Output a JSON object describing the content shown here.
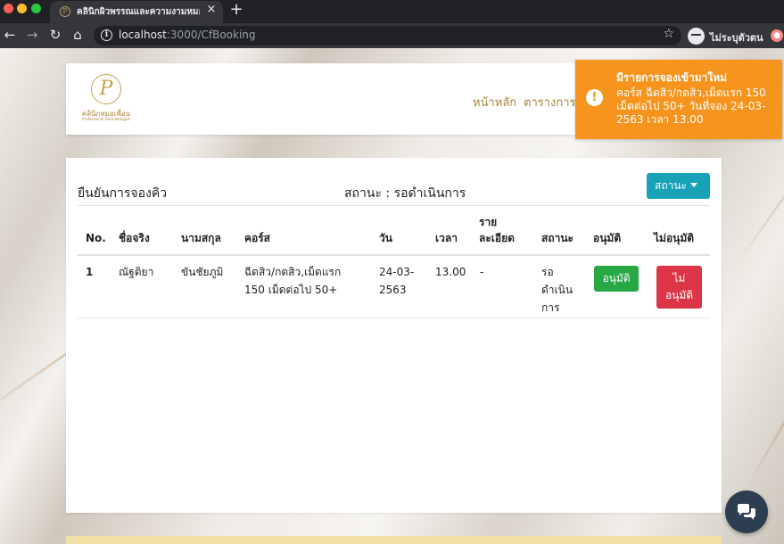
{
  "browser": {
    "tab_title": "คลินิกผิวพรรณและความงามหมอเพื่อน",
    "tab_close": "×",
    "new_tab": "+",
    "url_host": "localhost",
    "url_path": ":3000/CfBooking",
    "profile_name": "ไม่ระบุตัวตน"
  },
  "navbar": {
    "logo_letter": "P",
    "logo_text": "คลินิกหมอเพื่อน",
    "logo_subtext": "Professional Dermatologist",
    "links": [
      "หน้าหลัก",
      "ตารางการจอง"
    ]
  },
  "toast": {
    "title": "มีรายการจองเข้ามาใหม่",
    "message": "คอร์ส ฉีดสิว/กดสิว,เม็ดแรก 150 เม็ดต่อไป 50+ วันที่จอง 24-03-2563 เวลา 13.00",
    "color": "#f7941d"
  },
  "page": {
    "title": "ยืนยันการจองคิว",
    "status_label": "สถานะ : รอดำเนินการ",
    "status_dropdown": "สถานะ"
  },
  "table": {
    "headers": {
      "no": "No.",
      "first_name": "ชื่อจริง",
      "last_name": "นามสกุล",
      "course": "คอร์ส",
      "date": "วัน",
      "time": "เวลา",
      "details_line1": "ราย",
      "details_line2": "ละเอียด",
      "status": "สถานะ",
      "approve": "อนุมัติ",
      "reject": "ไม่อนุมัติ"
    },
    "rows": [
      {
        "no": "1",
        "first_name": "ณัฐติยา",
        "last_name": "ขันชัยภูมิ",
        "course_line1": "ฉีดสิว/กดสิว,เม็ดแรก",
        "course_line2": "150 เม็ดต่อไป 50+",
        "date_line1": "24-03-",
        "date_line2": "2563",
        "time": "13.00",
        "details": "-",
        "status_line1": "รอ",
        "status_line2": "ดำเนิน",
        "status_line3": "การ",
        "approve_label": "อนุมัติ",
        "reject_line1": "ไม่",
        "reject_line2": "อนุมัติ"
      }
    ]
  },
  "colors": {
    "accent_gold": "#a8843b",
    "info": "#17a2b8",
    "success": "#28a745",
    "danger": "#dc3545"
  }
}
